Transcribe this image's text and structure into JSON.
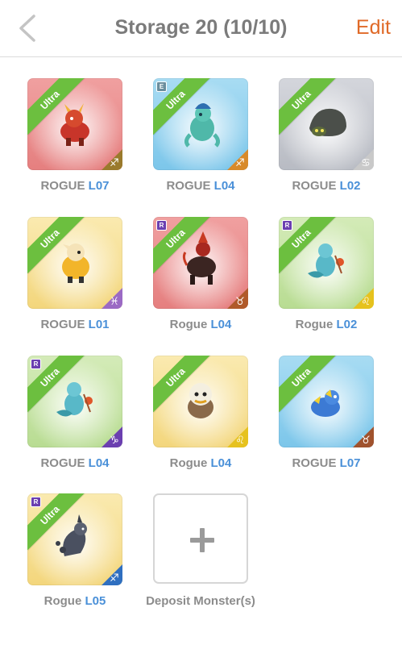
{
  "header": {
    "title": "Storage 20 (10/10)",
    "edit_label": "Edit"
  },
  "colors": {
    "accent": "#e06a28",
    "level": "#4a90d8",
    "ribbon": "#6cbf3f"
  },
  "monsters": [
    {
      "name": "ROGUE",
      "level": "L07",
      "rarity": "Ultra",
      "bg": "red",
      "badge": "",
      "zodiac": "sagittarius-icon"
    },
    {
      "name": "ROGUE",
      "level": "L04",
      "rarity": "Ultra",
      "bg": "blue",
      "badge": "E",
      "zodiac": "sagittarius-icon"
    },
    {
      "name": "ROGUE",
      "level": "L02",
      "rarity": "Ultra",
      "bg": "gray",
      "badge": "",
      "zodiac": "cancer-icon"
    },
    {
      "name": "ROGUE",
      "level": "L01",
      "rarity": "Ultra",
      "bg": "yellow",
      "badge": "",
      "zodiac": "pisces-icon"
    },
    {
      "name": "Rogue",
      "level": "L04",
      "rarity": "Ultra",
      "bg": "red",
      "badge": "R",
      "zodiac": "taurus-icon"
    },
    {
      "name": "Rogue",
      "level": "L02",
      "rarity": "Ultra",
      "bg": "green",
      "badge": "R",
      "zodiac": "leo-icon"
    },
    {
      "name": "ROGUE",
      "level": "L04",
      "rarity": "Ultra",
      "bg": "green",
      "badge": "R",
      "zodiac": "capricorn-icon"
    },
    {
      "name": "Rogue",
      "level": "L04",
      "rarity": "Ultra",
      "bg": "yellow",
      "badge": "",
      "zodiac": "leo-icon"
    },
    {
      "name": "ROGUE",
      "level": "L07",
      "rarity": "Ultra",
      "bg": "blue",
      "badge": "",
      "zodiac": "taurus-icon"
    },
    {
      "name": "Rogue",
      "level": "L05",
      "rarity": "Ultra",
      "bg": "yellow",
      "badge": "R",
      "zodiac": "sagittarius-icon"
    }
  ],
  "deposit": {
    "label": "Deposit Monster(s)"
  }
}
